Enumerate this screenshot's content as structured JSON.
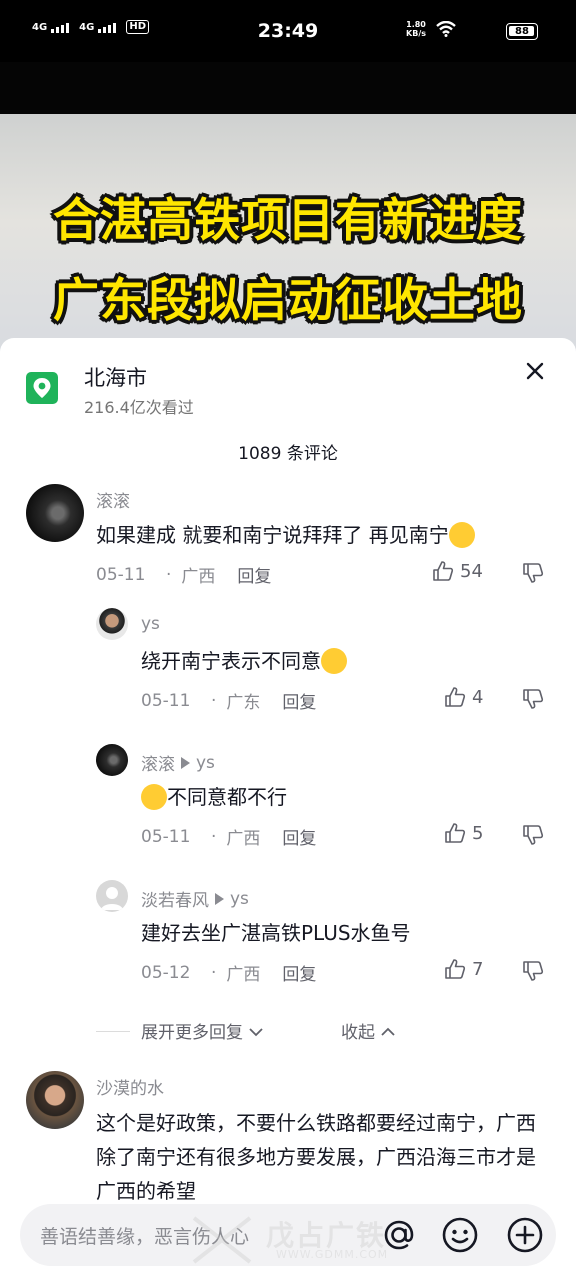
{
  "status": {
    "left_net1": "4G",
    "left_net2": "4G",
    "hd": "HD",
    "hd_sub": "1\n2",
    "time": "23:49",
    "speed_value": "1.80",
    "speed_unit": "KB/s",
    "battery": "88"
  },
  "video": {
    "headline_line1": "合湛高铁项目有新进度",
    "headline_line2": "广东段拟启动征收土地"
  },
  "sheet": {
    "location_name": "北海市",
    "views": "216.4亿次看过",
    "comment_count": "1089 条评论"
  },
  "comments": [
    {
      "user": "滚滚",
      "text": "如果建成 就要和南宁说拜拜了 再见南宁",
      "emoji": "grin-emoji",
      "date": "05-11",
      "region": "广西",
      "reply": "回复",
      "likes": "54"
    },
    {
      "user": "ys",
      "text": "绕开南宁表示不同意",
      "emoji": "laugh-cry-emoji",
      "date": "05-11",
      "region": "广东",
      "reply": "回复",
      "likes": "4"
    },
    {
      "user": "滚滚",
      "reply_to": "ys",
      "text": "不同意都不行",
      "emoji": "grin-emoji",
      "date": "05-11",
      "region": "广西",
      "reply": "回复",
      "likes": "5"
    },
    {
      "user": "淡若春风",
      "reply_to": "ys",
      "text": "建好去坐广湛高铁PLUS水鱼号",
      "date": "05-12",
      "region": "广西",
      "reply": "回复",
      "likes": "7"
    },
    {
      "user": "沙漠的水",
      "text": "这个是好政策，不要什么铁路都要经过南宁，广西除了南宁还有很多地方要发展，广西沿海三市才是广西的希望"
    }
  ],
  "thread": {
    "expand": "展开更多回复",
    "collapse": "收起"
  },
  "input": {
    "placeholder": "善语结善缘，恶言伤人心"
  },
  "watermark": {
    "text": "戊占广铁",
    "url": "WWW.GDMM.COM"
  },
  "colors": {
    "location_green": "#1fb35a",
    "headline_yellow": "#ffe600",
    "muted_text": "#8a8b91"
  }
}
